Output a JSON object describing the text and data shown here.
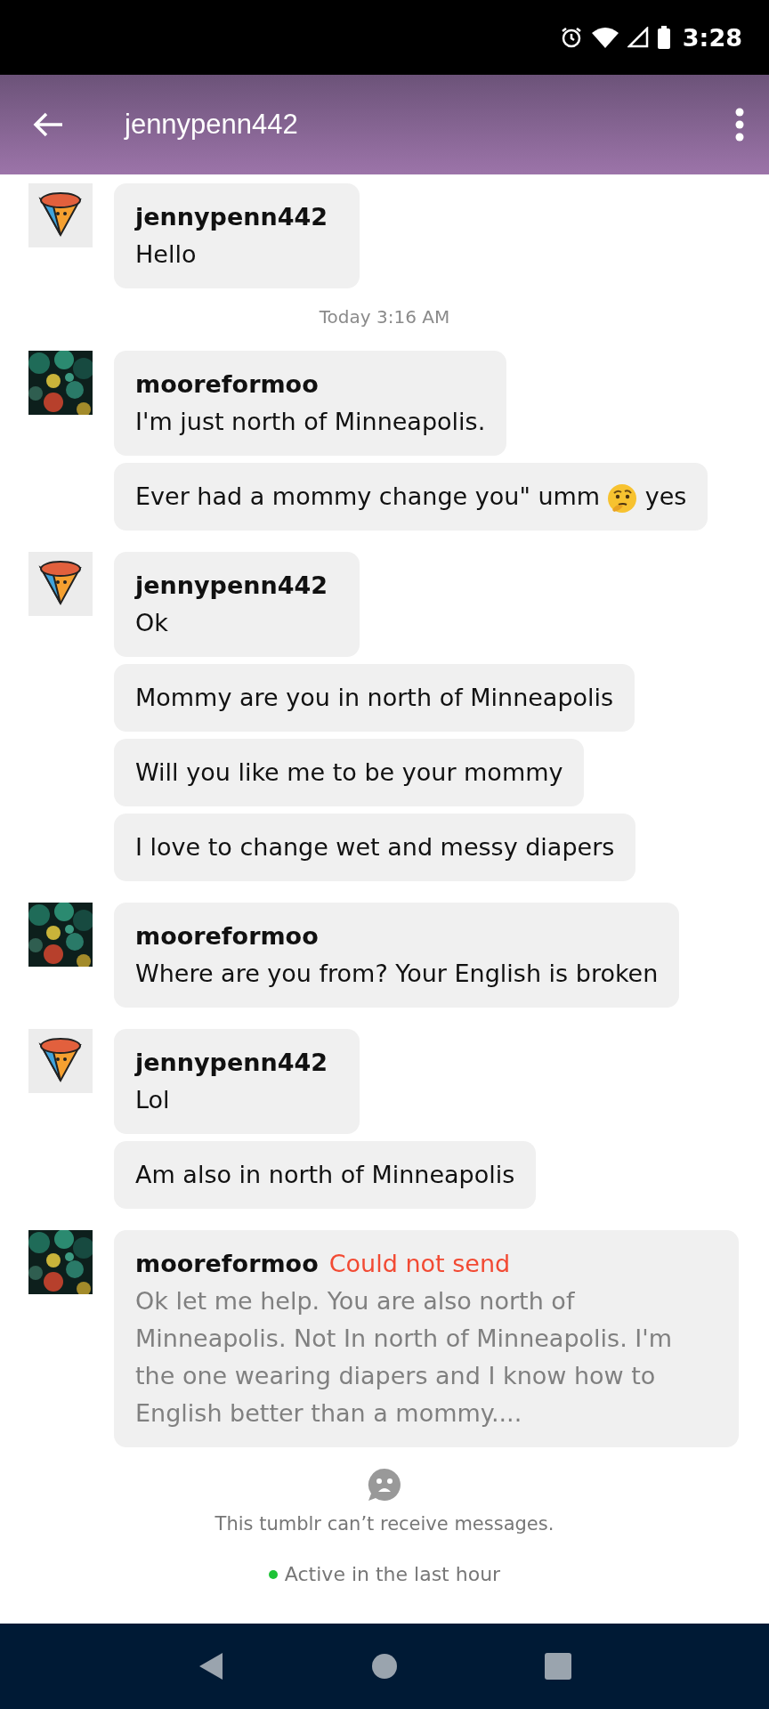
{
  "status_bar": {
    "time": "3:28"
  },
  "header": {
    "title": "jennypenn442"
  },
  "conversation": [
    {
      "kind": "group",
      "avatar": {
        "kind": "cone"
      },
      "sender": "jennypenn442",
      "messages": [
        {
          "text": "Hello"
        }
      ]
    },
    {
      "kind": "timestamp",
      "text": "Today 3:16 AM"
    },
    {
      "kind": "group",
      "avatar": {
        "kind": "picture"
      },
      "sender": "mooreformoo",
      "messages": [
        {
          "text": "I'm just north of Minneapolis."
        },
        {
          "text": "Ever had a mommy change you\" umm",
          "emoji": {
            "kind": "thinking"
          },
          "text_after": "yes"
        }
      ]
    },
    {
      "kind": "group",
      "avatar": {
        "kind": "cone"
      },
      "sender": "jennypenn442",
      "messages": [
        {
          "text": "Ok"
        },
        {
          "text": "Mommy are you in north of Minneapolis"
        },
        {
          "text": "Will you like me to be your mommy"
        },
        {
          "text": "I love to change wet and messy diapers"
        }
      ]
    },
    {
      "kind": "group",
      "avatar": {
        "kind": "picture"
      },
      "sender": "mooreformoo",
      "messages": [
        {
          "text": "Where are you from? Your English is broken"
        }
      ]
    },
    {
      "kind": "group",
      "avatar": {
        "kind": "cone"
      },
      "sender": "jennypenn442",
      "messages": [
        {
          "text": "Lol"
        },
        {
          "text": "Am also in north of Minneapolis"
        }
      ]
    },
    {
      "kind": "group",
      "avatar": {
        "kind": "picture"
      },
      "sender": "mooreformoo",
      "messages": [
        {
          "text": "Ok let me help. You are also north of Minneapolis. Not In north of Minneapolis. I'm the one wearing diapers and I know how to English better than a mommy....",
          "failed": true,
          "error": "Could not send"
        }
      ]
    }
  ],
  "notice": {
    "text": "This tumblr can’t receive messages."
  },
  "presence": {
    "text": "Active in the last hour",
    "color": "#1ec337"
  }
}
